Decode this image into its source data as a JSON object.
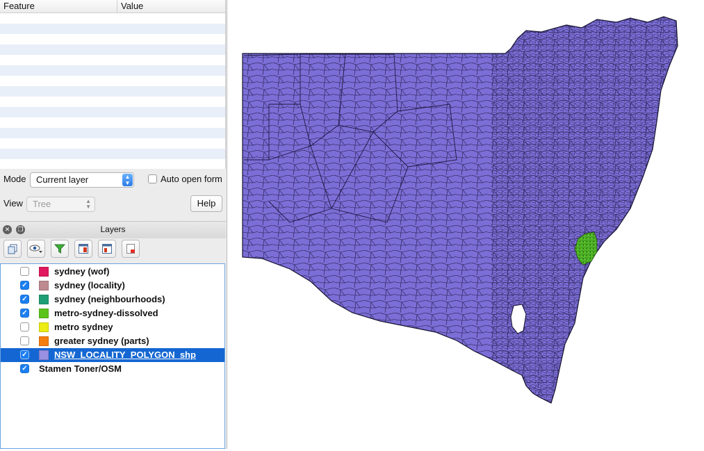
{
  "identify": {
    "columns": [
      "Feature",
      "Value"
    ],
    "mode_label": "Mode",
    "mode_value": "Current layer",
    "auto_open_label": "Auto open form",
    "view_label": "View",
    "view_value": "Tree",
    "help_label": "Help"
  },
  "layers_panel": {
    "title": "Layers",
    "layers": [
      {
        "name": "sydney (wof)",
        "checked": false,
        "color": "#e0185f"
      },
      {
        "name": "sydney (locality)",
        "checked": true,
        "color": "#bd8a8f"
      },
      {
        "name": "sydney (neighbourhoods)",
        "checked": true,
        "color": "#1f9e74"
      },
      {
        "name": "metro-sydney-dissolved",
        "checked": true,
        "color": "#5bc41c"
      },
      {
        "name": "metro sydney",
        "checked": false,
        "color": "#ecec16"
      },
      {
        "name": "greater sydney (parts)",
        "checked": false,
        "color": "#f47e0f"
      },
      {
        "name": "NSW_LOCALITY_POLYGON_shp",
        "checked": true,
        "color": "#9a90e2",
        "selected": true
      },
      {
        "name": "Stamen Toner/OSM",
        "checked": true
      }
    ]
  },
  "map": {
    "fill_color": "#7b6ed6",
    "highlight_color": "#57c42a"
  }
}
